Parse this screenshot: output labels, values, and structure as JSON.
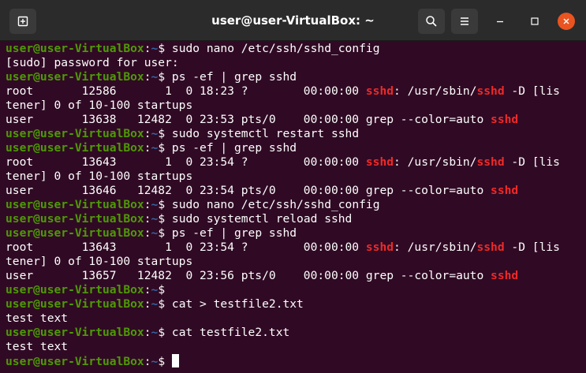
{
  "window": {
    "title": "user@user-VirtualBox: ~"
  },
  "titlebar": {
    "new_tab_icon": "new-tab-icon",
    "search_icon": "search-icon",
    "menu_icon": "hamburger-menu-icon",
    "minimize_icon": "minimize-icon",
    "maximize_icon": "maximize-icon",
    "close_icon": "close-icon"
  },
  "colors": {
    "terminal_bg": "#300a24",
    "prompt_user": "#4e9a06",
    "prompt_path": "#3465a4",
    "grep_highlight": "#ef2929",
    "close_button": "#e95420"
  },
  "prompt": {
    "user_host": "user@user-VirtualBox",
    "colon": ":",
    "path": "~",
    "symbol": "$ "
  },
  "terminal": {
    "lines": [
      {
        "type": "cmd",
        "text": "sudo nano /etc/ssh/sshd_config"
      },
      {
        "type": "out",
        "text": "[sudo] password for user:"
      },
      {
        "type": "cmd",
        "text": "ps -ef | grep sshd"
      },
      {
        "type": "hl",
        "parts": [
          "root       12586       1  0 18:23 ?        00:00:00 ",
          "sshd",
          ": /usr/sbin/",
          "sshd",
          " -D [lis"
        ]
      },
      {
        "type": "out",
        "text": "tener] 0 of 10-100 startups"
      },
      {
        "type": "hl",
        "parts": [
          "user       13638   12482  0 23:53 pts/0    00:00:00 grep --color=auto ",
          "sshd"
        ]
      },
      {
        "type": "cmd",
        "text": "sudo systemctl restart sshd"
      },
      {
        "type": "cmd",
        "text": "ps -ef | grep sshd"
      },
      {
        "type": "hl",
        "parts": [
          "root       13643       1  0 23:54 ?        00:00:00 ",
          "sshd",
          ": /usr/sbin/",
          "sshd",
          " -D [lis"
        ]
      },
      {
        "type": "out",
        "text": "tener] 0 of 10-100 startups"
      },
      {
        "type": "hl",
        "parts": [
          "user       13646   12482  0 23:54 pts/0    00:00:00 grep --color=auto ",
          "sshd"
        ]
      },
      {
        "type": "cmd",
        "text": "sudo nano /etc/ssh/sshd_config"
      },
      {
        "type": "cmd",
        "text": "sudo systemctl reload sshd"
      },
      {
        "type": "cmd",
        "text": "ps -ef | grep sshd"
      },
      {
        "type": "hl",
        "parts": [
          "root       13643       1  0 23:54 ?        00:00:00 ",
          "sshd",
          ": /usr/sbin/",
          "sshd",
          " -D [lis"
        ]
      },
      {
        "type": "out",
        "text": "tener] 0 of 10-100 startups"
      },
      {
        "type": "hl",
        "parts": [
          "user       13657   12482  0 23:56 pts/0    00:00:00 grep --color=auto ",
          "sshd"
        ]
      },
      {
        "type": "cmd",
        "text": ""
      },
      {
        "type": "cmd",
        "text": "cat > testfile2.txt"
      },
      {
        "type": "out",
        "text": "test text"
      },
      {
        "type": "cmd",
        "text": "cat testfile2.txt"
      },
      {
        "type": "out",
        "text": "test text"
      },
      {
        "type": "cursor",
        "text": ""
      }
    ]
  }
}
